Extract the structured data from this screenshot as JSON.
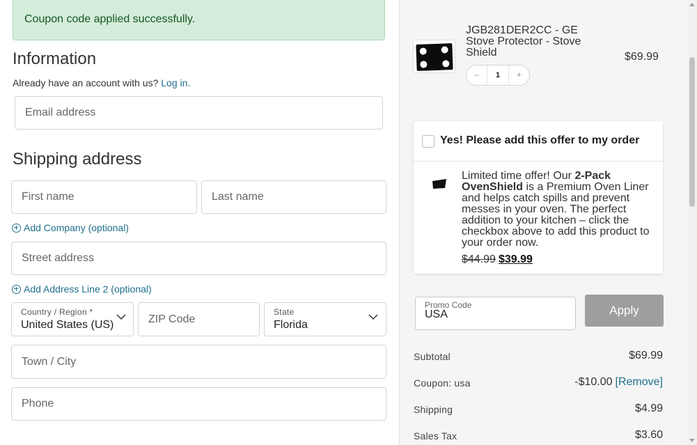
{
  "notice": {
    "text": "Coupon code applied successfully."
  },
  "information": {
    "title": "Information",
    "account_prompt": "Already have an account with us? ",
    "login_link": "Log in.",
    "email_placeholder": "Email address"
  },
  "shipping": {
    "title": "Shipping address",
    "first_name_placeholder": "First name",
    "last_name_placeholder": "Last name",
    "add_company": "Add Company (optional)",
    "street_placeholder": "Street address",
    "add_line2": "Add Address Line 2 (optional)",
    "country_label": "Country / Region *",
    "country_value": "United States (US)",
    "zip_placeholder": "ZIP Code",
    "state_label": "State",
    "state_value": "Florida",
    "city_placeholder": "Town / City",
    "phone_placeholder": "Phone"
  },
  "cart": {
    "product_name": "JGB281DER2CC - GE Stove Protector - Stove Shield",
    "product_price": "$69.99",
    "quantity": "1",
    "qty_minus": "–",
    "qty_plus": "+"
  },
  "offer": {
    "checkbox_label": "Yes! Please add this offer to my order",
    "text_prefix": "Limited time offer! Our ",
    "text_bold": "2-Pack OvenShield",
    "text_suffix": " is a Premium Oven Liner and helps catch spills and prevent messes in your oven. The perfect addition to your kitchen – click the checkbox above to add this product to your order now.",
    "old_price": "$44.99",
    "new_price": "$39.99"
  },
  "promo": {
    "label": "Promo Code",
    "value": "USA",
    "apply_label": "Apply"
  },
  "summary": {
    "subtotal_label": "Subtotal",
    "subtotal_value": "$69.99",
    "coupon_label": "Coupon: usa",
    "coupon_value": "-$10.00",
    "remove_label": "[Remove]",
    "shipping_label": "Shipping",
    "shipping_value": "$4.99",
    "tax_label": "Sales Tax",
    "tax_value": "$3.60"
  },
  "icons": [
    "plus-circle-icon",
    "chevron-down-icon",
    "product-thumbnail",
    "offer-product-icon"
  ],
  "colors": {
    "success_bg": "#d4edda",
    "success_text": "#155724",
    "link": "#1e6f8c",
    "apply_bg": "#9e9e9e"
  }
}
